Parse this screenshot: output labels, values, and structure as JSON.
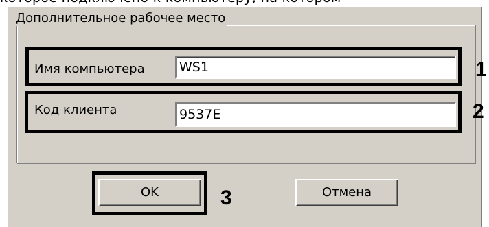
{
  "header_partial_text": "которое подключено к компьютеру, на котором",
  "dialog": {
    "group_title": "Дополнительное рабочее место",
    "fields": [
      {
        "label": "Имя компьютера",
        "value": "WS1"
      },
      {
        "label": "Код клиента",
        "value": "9537E"
      }
    ],
    "buttons": {
      "ok": "OK",
      "cancel": "Отмена"
    }
  },
  "annotations": {
    "one": "1",
    "two": "2",
    "three": "3"
  }
}
